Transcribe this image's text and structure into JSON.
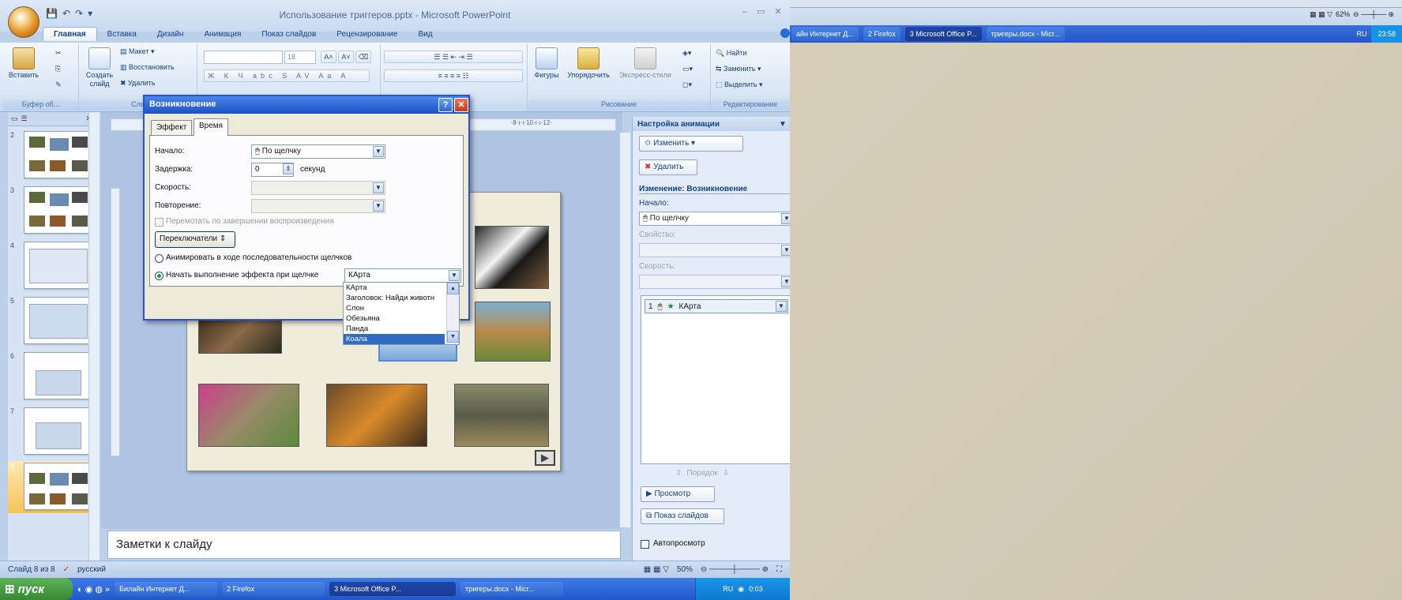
{
  "window": {
    "title": "Использование триггеров.pptx - Microsoft PowerPoint",
    "tabs": [
      "Главная",
      "Вставка",
      "Дизайн",
      "Анимация",
      "Показ слайдов",
      "Рецензирование",
      "Вид"
    ]
  },
  "ribbon": {
    "clipboard": {
      "paste": "Вставить",
      "label": "Буфер об..."
    },
    "slides": {
      "new_slide": "Создать слайд",
      "layout": "Макет",
      "reset": "Восстановить",
      "delete": "Удалить",
      "label": "Сла"
    },
    "font": {
      "size": "18"
    },
    "drawing": {
      "shapes": "Фигуры",
      "arrange": "Упорядочить",
      "styles": "Экспресс-стили",
      "label": "Рисование"
    },
    "editing": {
      "find": "Найти",
      "replace": "Заменить",
      "select": "Выделить",
      "label": "Редактирование"
    }
  },
  "thumbnails": [
    {
      "num": "2",
      "selected": false
    },
    {
      "num": "3",
      "selected": false
    },
    {
      "num": "4",
      "selected": false
    },
    {
      "num": "5",
      "selected": false
    },
    {
      "num": "6",
      "selected": false
    },
    {
      "num": "7",
      "selected": false
    },
    {
      "num": "8",
      "selected": true
    }
  ],
  "ruler": {
    "marks": "·8·ı·ı·10·ı·ı·12·"
  },
  "notes": {
    "placeholder": "Заметки к слайду"
  },
  "dialog": {
    "title": "Возникновение",
    "tabs": [
      "Эффект",
      "Время"
    ],
    "start_label": "Начало:",
    "start_value": "По щелчку",
    "delay_label": "Задержка:",
    "delay_value": "0",
    "delay_unit": "секунд",
    "speed_label": "Скорость:",
    "repeat_label": "Повторение:",
    "rewind_label": "Перемотать по завершении воспроизведения",
    "triggers_button": "Переключатели",
    "radio_sequence": "Анимировать в ходе последовательности щелчков",
    "radio_trigger": "Начать выполнение эффекта при щелчке",
    "trigger_value": "КАрта",
    "list_items": [
      "КАрта",
      "Заголовок: Найди животн",
      "Слон",
      "Обезьяна",
      "Панда",
      "Коала"
    ],
    "list_selected": "Коала"
  },
  "anim_panel": {
    "title": "Настройка анимации",
    "change_button": "Изменить",
    "delete_button": "Удалить",
    "section_title": "Изменение: Возникновение",
    "start_label": "Начало:",
    "start_value": "По щелчку",
    "property_label": "Свойство:",
    "speed_label": "Скорость:",
    "list_item_num": "1",
    "list_item_label": "КАрта",
    "order_label": "Порядок",
    "preview_button": "Просмотр",
    "slideshow_button": "Показ слайдов",
    "autopreview_label": "Автопросмотр"
  },
  "statusbar": {
    "slide_info": "Слайд 8 из 8",
    "language": "русский",
    "zoom": "50%"
  },
  "taskbar": {
    "start": "пуск",
    "items": [
      "Билайн Интернет Д...",
      "2 Firefox",
      "3 Microsoft Office P...",
      "тригеры.docx - Micr..."
    ],
    "lang": "RU",
    "time": "0:03"
  },
  "bg_screen": {
    "zoom": "62%",
    "items": [
      "айн Интернет Д...",
      "2 Firefox",
      "3 Microsoft Office P...",
      "тригеры.docx - Micr..."
    ],
    "lang": "RU",
    "time": "23:58"
  },
  "colors": {
    "accent": "#2a55c8",
    "ribbon": "#dbe7f6",
    "taskbar": "#2257cc",
    "start": "#368a32"
  }
}
